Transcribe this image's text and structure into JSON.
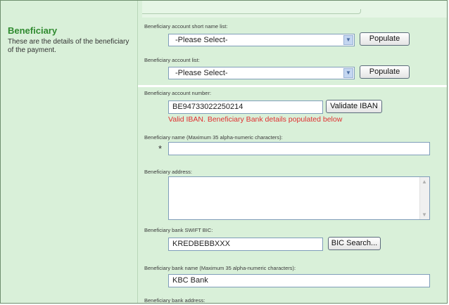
{
  "section": {
    "title": "Beneficiary",
    "description": "These are the details of the beneficiary of the payment."
  },
  "fields": {
    "short_name_list": {
      "label": "Beneficiary account short name list:",
      "selected": "-Please Select-",
      "button": "Populate"
    },
    "account_list": {
      "label": "Beneficiary account list:",
      "selected": "-Please Select-",
      "button": "Populate"
    },
    "account_number": {
      "label": "Beneficiary account number:",
      "value": "BE94733022250214",
      "button": "Validate IBAN",
      "message": "Valid IBAN. Beneficiary Bank details populated below"
    },
    "name": {
      "label": "Beneficiary name (Maximum 35 alpha-numeric characters):",
      "required_marker": "*",
      "value": ""
    },
    "address": {
      "label": "Beneficiary address:",
      "value": ""
    },
    "swift_bic": {
      "label": "Beneficiary bank SWIFT BIC:",
      "value": "KREDBEBBXXX",
      "button": "BIC Search..."
    },
    "bank_name": {
      "label": "Beneficiary bank name (Maximum 35 alpha-numeric characters):",
      "value": "KBC Bank"
    },
    "bank_address": {
      "label": "Beneficiary bank address:"
    }
  },
  "icons": {
    "dropdown": "chevron-down-icon",
    "scroll_up": "scroll-up-arrow-icon",
    "scroll_down": "scroll-down-arrow-icon"
  },
  "colors": {
    "panel_bg": "#d9f0d9",
    "title_green": "#2f8a2f",
    "error_red": "#e03030"
  }
}
